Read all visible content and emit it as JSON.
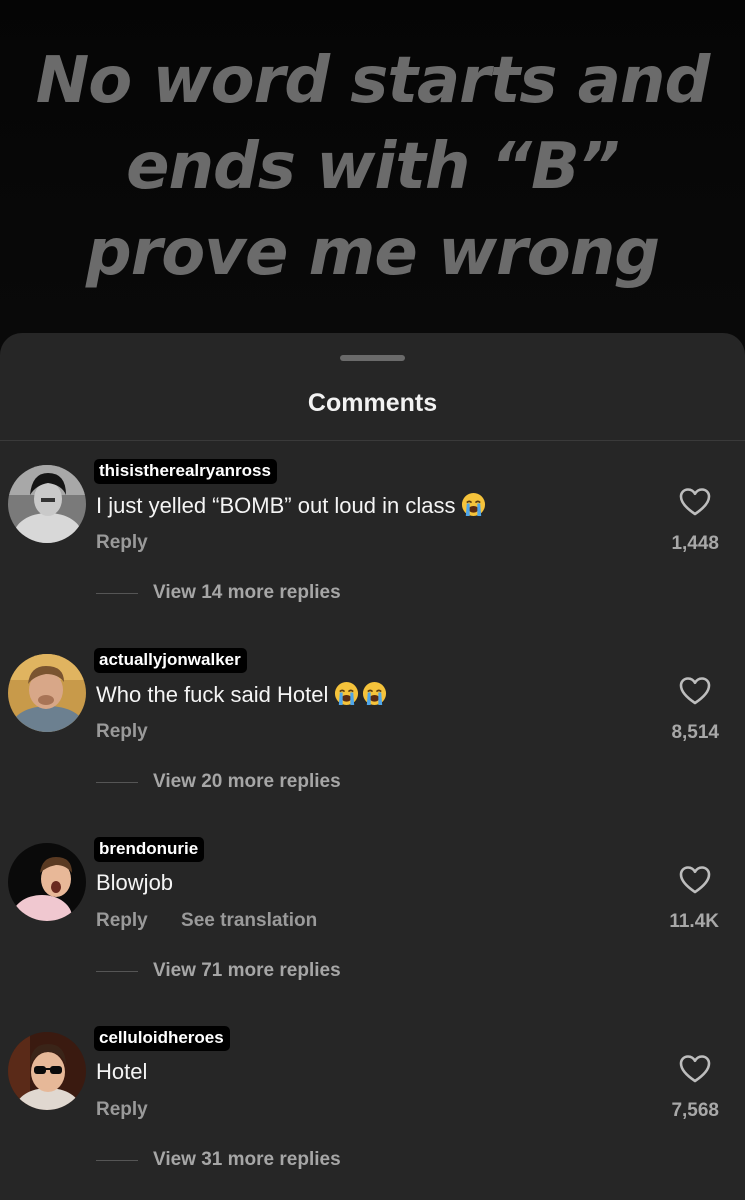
{
  "video": {
    "caption": "No word starts and ends with “B” prove me wrong"
  },
  "comments_sheet": {
    "title": "Comments"
  },
  "comments": [
    {
      "username": "thisistherealryanross",
      "text": "I just yelled “BOMB” out loud in class",
      "emoji_count": 1,
      "emoji": "loudly-crying-face",
      "reply_label": "Reply",
      "likes": "1,448",
      "view_replies": "View 14 more replies"
    },
    {
      "username": "actuallyjonwalker",
      "text": "Who the fuck said Hotel",
      "emoji_count": 2,
      "emoji": "loudly-crying-face",
      "reply_label": "Reply",
      "likes": "8,514",
      "view_replies": "View 20 more replies"
    },
    {
      "username": "brendonurie",
      "text": "Blowjob",
      "emoji_count": 0,
      "reply_label": "Reply",
      "translation_label": "See translation",
      "likes": "11.4K",
      "view_replies": "View 71 more replies"
    },
    {
      "username": "celluloidheroes",
      "text": "Hotel",
      "emoji_count": 0,
      "reply_label": "Reply",
      "likes": "7,568",
      "view_replies": "View 31 more replies"
    }
  ],
  "colors": {
    "sheet_background": "#262626",
    "caption_text": "#6b6b6b",
    "username_badge": "#000000",
    "secondary_text": "#9a9a9a"
  }
}
